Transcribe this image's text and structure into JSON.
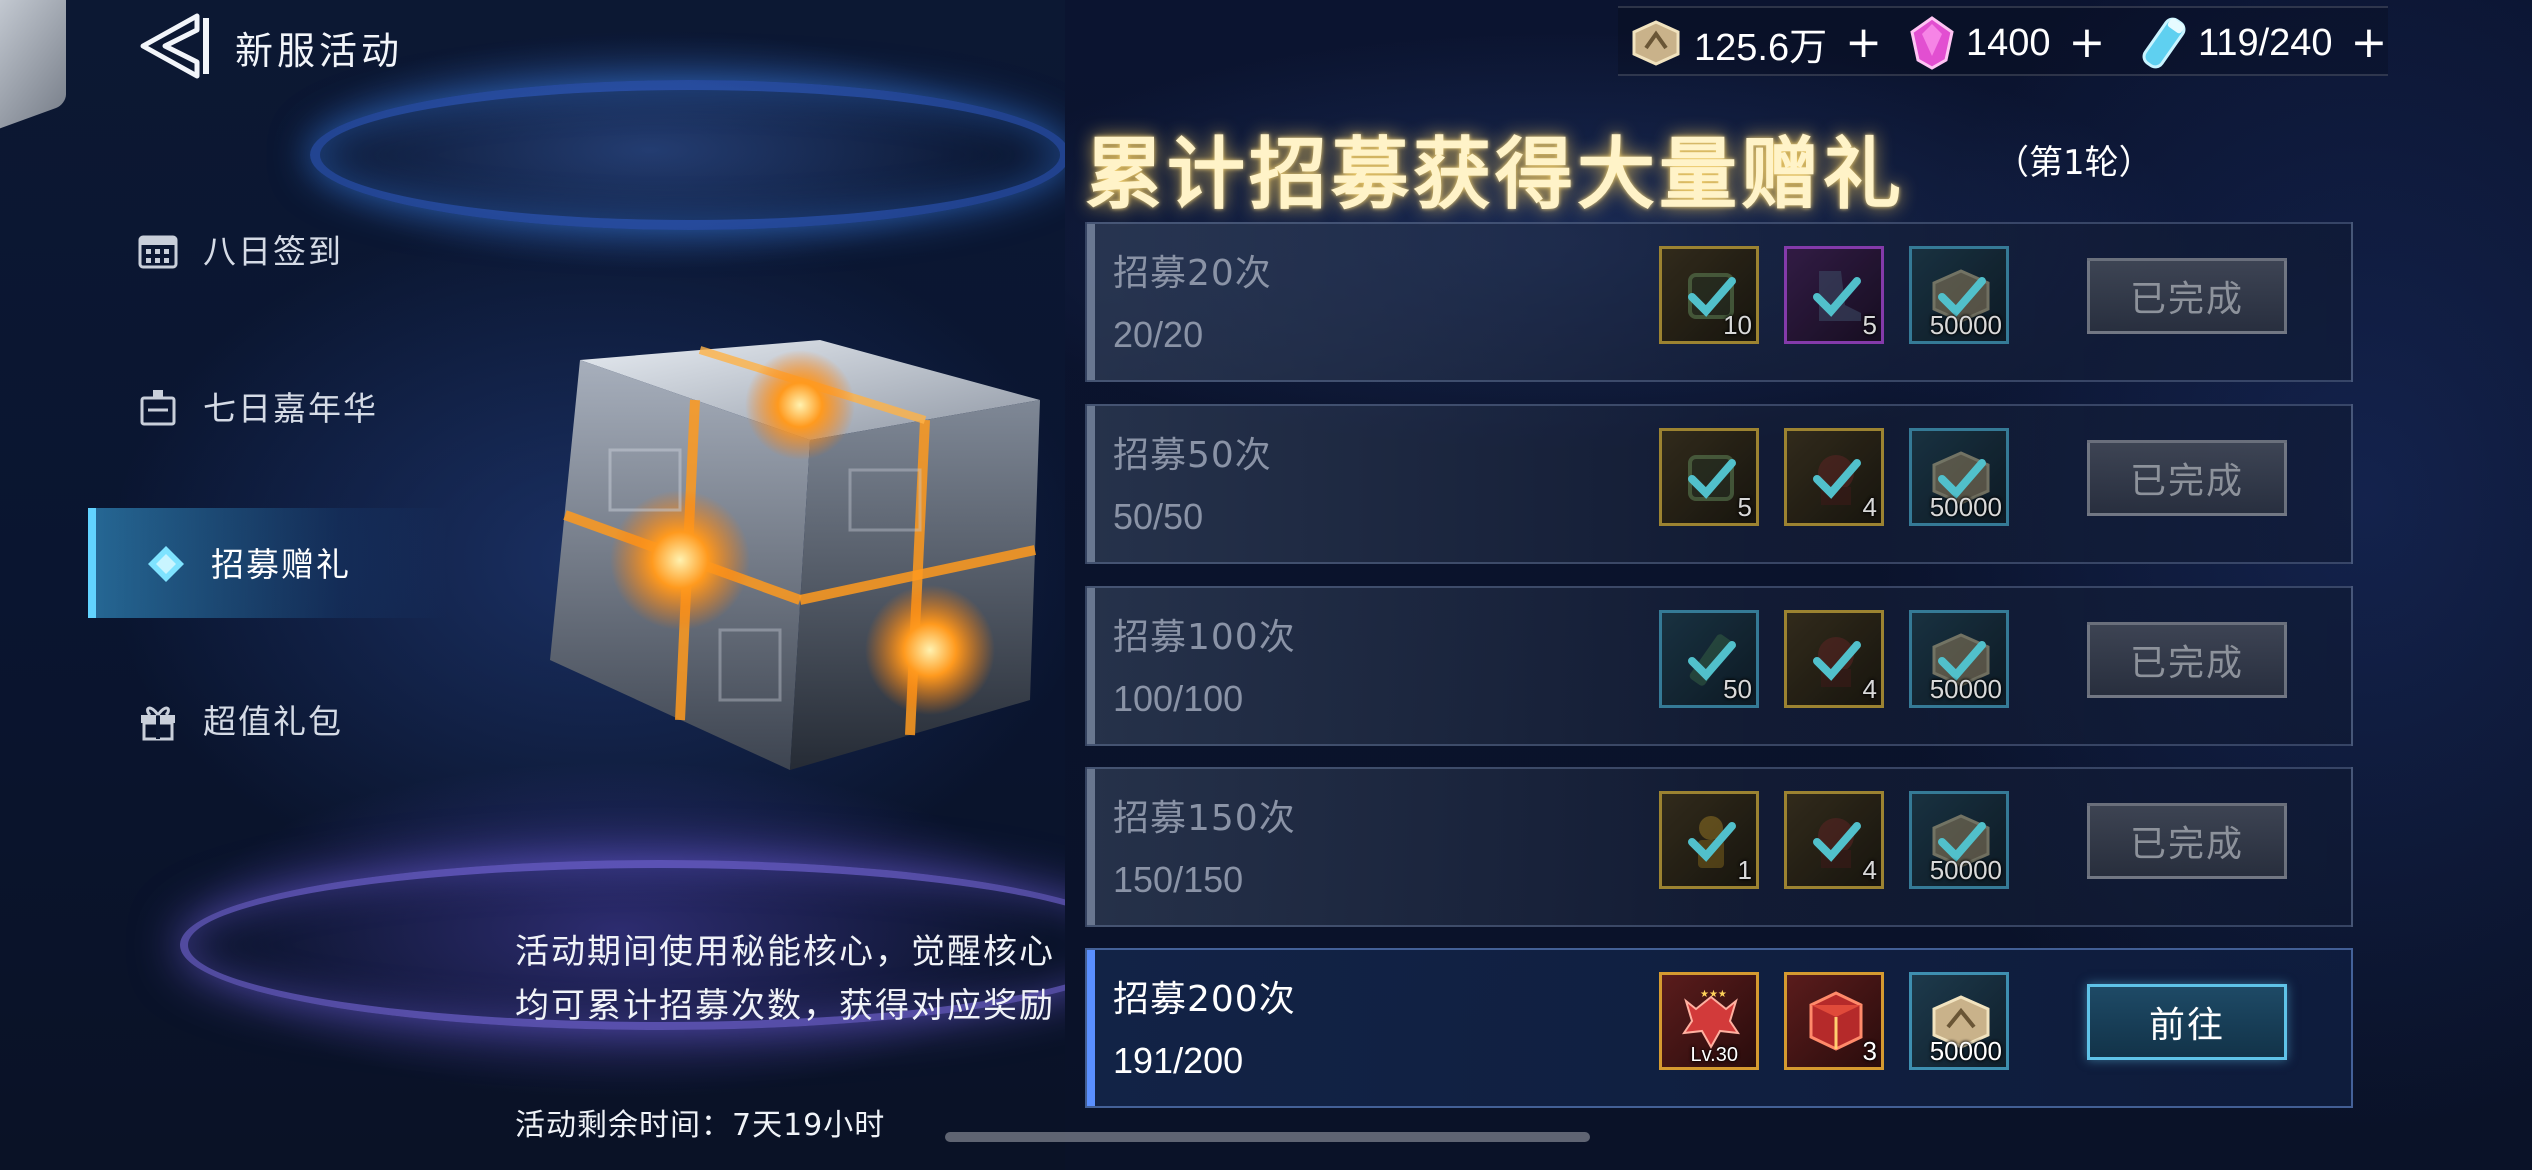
{
  "header": {
    "title": "新服活动"
  },
  "currencies": [
    {
      "icon": "gold-coin-icon",
      "value": "125.6万"
    },
    {
      "icon": "pink-crystal-icon",
      "value": "1400"
    },
    {
      "icon": "stamina-vial-icon",
      "value": "119/240"
    }
  ],
  "currency_plus": "+",
  "sidebar": {
    "items": [
      {
        "label": "八日签到",
        "icon": "calendar-icon"
      },
      {
        "label": "七日嘉年华",
        "icon": "carnival-icon"
      },
      {
        "label": "招募赠礼",
        "icon": "diamond-icon",
        "active": true
      },
      {
        "label": "超值礼包",
        "icon": "gift-icon"
      }
    ]
  },
  "event": {
    "description": "活动期间使用秘能核心，觉醒核心均可累计招募次数，获得对应奖励",
    "remaining": "活动剩余时间：7天19小时"
  },
  "panel": {
    "title": "累计招募获得大量赠礼",
    "round": "（第1轮）"
  },
  "tiers": [
    {
      "title": "招募20次",
      "progress": "20/20",
      "button": "已完成",
      "completed": true,
      "rewards": [
        {
          "qty": "10"
        },
        {
          "qty": "5"
        },
        {
          "qty": "50000"
        }
      ]
    },
    {
      "title": "招募50次",
      "progress": "50/50",
      "button": "已完成",
      "completed": true,
      "rewards": [
        {
          "qty": "5"
        },
        {
          "qty": "4"
        },
        {
          "qty": "50000"
        }
      ]
    },
    {
      "title": "招募100次",
      "progress": "100/100",
      "button": "已完成",
      "completed": true,
      "rewards": [
        {
          "qty": "50"
        },
        {
          "qty": "4"
        },
        {
          "qty": "50000"
        }
      ]
    },
    {
      "title": "招募150次",
      "progress": "150/150",
      "button": "已完成",
      "completed": true,
      "rewards": [
        {
          "qty": "1"
        },
        {
          "qty": "4"
        },
        {
          "qty": "50000"
        }
      ]
    },
    {
      "title": "招募200次",
      "progress": "191/200",
      "button": "前往",
      "completed": false,
      "rewards": [
        {
          "qty": "Lv.30"
        },
        {
          "qty": "3"
        },
        {
          "qty": "50000"
        }
      ]
    }
  ],
  "colors": {
    "accent": "#5fc3e8",
    "title_glow": "#ffd25a",
    "gold_border": "#b89a3a",
    "purple_border": "#9b44c8",
    "blue_border": "#3e8fb0"
  }
}
